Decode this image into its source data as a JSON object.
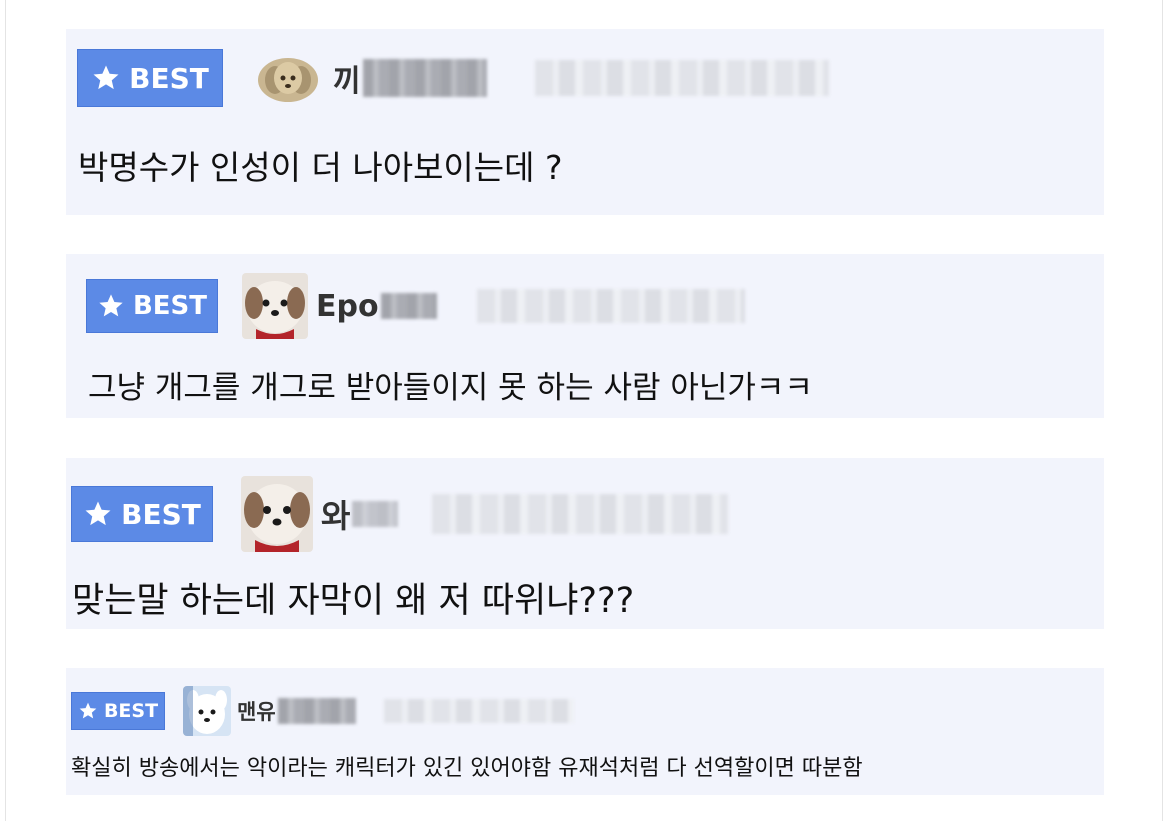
{
  "badge_label": "BEST",
  "comments": [
    {
      "nickname": "끼",
      "text": "박명수가 인성이 더 나아보이는데 ?"
    },
    {
      "nickname": "Epo",
      "text": "그냥 개그를 개그로 받아들이지 못 하는 사람 아닌가ㅋㅋ"
    },
    {
      "nickname": "와",
      "text": "맞는말 하는데 자막이 왜 저 따위냐???"
    },
    {
      "nickname": "맨유",
      "text": "확실히 방송에서는 악이라는 캐릭터가 있긴 있어야함 유재석처럼 다 선역할이면 따분함"
    }
  ],
  "colors": {
    "badge": "#5c8ae6",
    "card_background": "#f2f4fc"
  },
  "icons": {
    "badge": "star-icon",
    "avatar": "dog-avatar"
  }
}
